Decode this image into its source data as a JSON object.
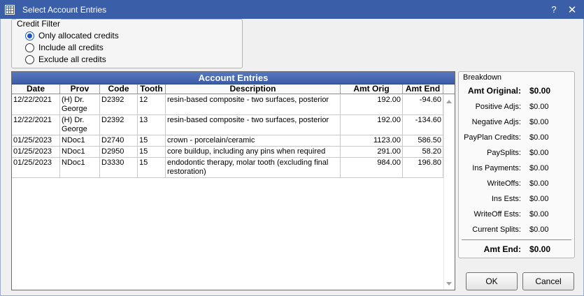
{
  "window": {
    "title": "Select Account Entries",
    "help_label": "?",
    "close_label": "✕"
  },
  "credit_filter": {
    "title": "Credit Filter",
    "options": [
      {
        "label": "Only allocated credits",
        "checked": true
      },
      {
        "label": "Include all credits",
        "checked": false
      },
      {
        "label": "Exclude all credits",
        "checked": false
      }
    ]
  },
  "grid": {
    "title": "Account Entries",
    "columns": [
      "Date",
      "Prov",
      "Code",
      "Tooth",
      "Description",
      "Amt Orig",
      "Amt End"
    ],
    "rows": [
      {
        "date": "12/22/2021",
        "prov": "(H) Dr. George",
        "code": "D2392",
        "tooth": "12",
        "desc": "resin-based composite - two surfaces, posterior",
        "orig": "192.00",
        "end": "-94.60"
      },
      {
        "date": "12/22/2021",
        "prov": "(H) Dr. George",
        "code": "D2392",
        "tooth": "13",
        "desc": "resin-based composite - two surfaces, posterior",
        "orig": "192.00",
        "end": "-134.60"
      },
      {
        "date": "01/25/2023",
        "prov": "NDoc1",
        "code": "D2740",
        "tooth": "15",
        "desc": "crown - porcelain/ceramic",
        "orig": "1123.00",
        "end": "586.50"
      },
      {
        "date": "01/25/2023",
        "prov": "NDoc1",
        "code": "D2950",
        "tooth": "15",
        "desc": "core buildup, including any pins when required",
        "orig": "291.00",
        "end": "58.20"
      },
      {
        "date": "01/25/2023",
        "prov": "NDoc1",
        "code": "D3330",
        "tooth": "15",
        "desc": "endodontic therapy, molar tooth (excluding final restoration)",
        "orig": "984.00",
        "end": "196.80"
      }
    ]
  },
  "breakdown": {
    "title": "Breakdown",
    "amt_original": {
      "label": "Amt Original:",
      "value": "$0.00"
    },
    "items": [
      {
        "label": "Positive Adjs:",
        "value": "$0.00"
      },
      {
        "label": "Negative Adjs:",
        "value": "$0.00"
      },
      {
        "label": "PayPlan Credits:",
        "value": "$0.00"
      },
      {
        "label": "PaySplits:",
        "value": "$0.00"
      },
      {
        "label": "Ins Payments:",
        "value": "$0.00"
      },
      {
        "label": "WriteOffs:",
        "value": "$0.00"
      },
      {
        "label": "Ins Ests:",
        "value": "$0.00"
      },
      {
        "label": "WriteOff Ests:",
        "value": "$0.00"
      },
      {
        "label": "Current Splits:",
        "value": "$0.00"
      }
    ],
    "amt_end": {
      "label": "Amt End:",
      "value": "$0.00"
    }
  },
  "buttons": {
    "ok": "OK",
    "cancel": "Cancel"
  }
}
